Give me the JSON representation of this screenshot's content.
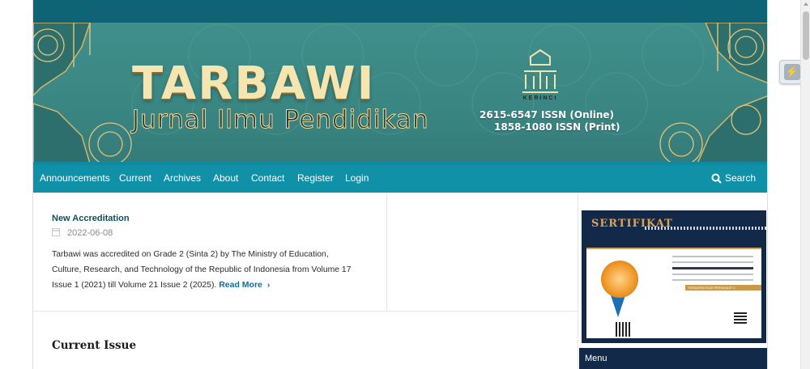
{
  "banner": {
    "title": "TARBAWI",
    "subtitle": "Jurnal Ilmu Pendidikan",
    "issn_online": "2615-6547 ISSN (Online)",
    "issn_print": "1858-1080 ISSN (Print)",
    "logo_caption": "KERINCI"
  },
  "nav": {
    "items": [
      "Announcements",
      "Current",
      "Archives",
      "About",
      "Contact",
      "Register",
      "Login"
    ],
    "search_label": "Search"
  },
  "announcement": {
    "title": "New Accreditation",
    "date": "2022-06-08",
    "text": "Tarbawi was accredited on Grade 2 (Sinta 2) by The Ministry of Education, Culture, Research, and Technology of the Republic of Indonesia from Volume 17 Issue 1 (2021) till Volume 21 Issue 2 (2025).",
    "read_more": "Read More"
  },
  "current_issue": {
    "heading": "Current Issue"
  },
  "sidebar": {
    "certificate_title": "SERTIFIKAT",
    "certificate_band_text": "TERAKREDITASI PERINGKAT 2",
    "menu_label": "Menu"
  },
  "colors": {
    "topbar": "#0e6475",
    "nav": "#1091a7",
    "banner": "#3a8683",
    "menu": "#12294a"
  }
}
